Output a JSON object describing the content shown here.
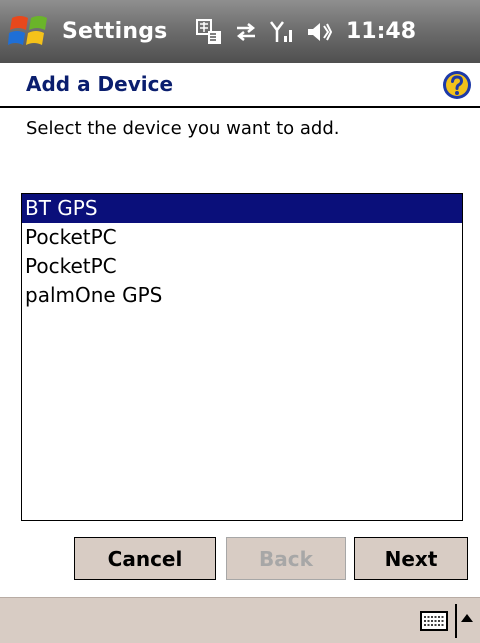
{
  "titlebar": {
    "title": "Settings",
    "clock": "11:48",
    "status_icons": [
      "input-method-icon",
      "connectivity-icon",
      "signal-icon",
      "speaker-icon"
    ]
  },
  "header": {
    "title": "Add a Device",
    "help_icon": "help-icon"
  },
  "instruction": "Select the device you want to add.",
  "devices": [
    {
      "label": "BT GPS",
      "selected": true
    },
    {
      "label": "PocketPC",
      "selected": false
    },
    {
      "label": "PocketPC",
      "selected": false
    },
    {
      "label": "palmOne GPS",
      "selected": false
    }
  ],
  "buttons": {
    "cancel": "Cancel",
    "back": "Back",
    "next": "Next"
  },
  "menubar": {
    "keyboard_icon": "keyboard-icon",
    "sip_arrow_icon": "sip-arrow-icon"
  },
  "colors": {
    "selection": "#0a0f7a",
    "title_blue": "#0a1e6e",
    "button_face": "#d8ccc4"
  }
}
